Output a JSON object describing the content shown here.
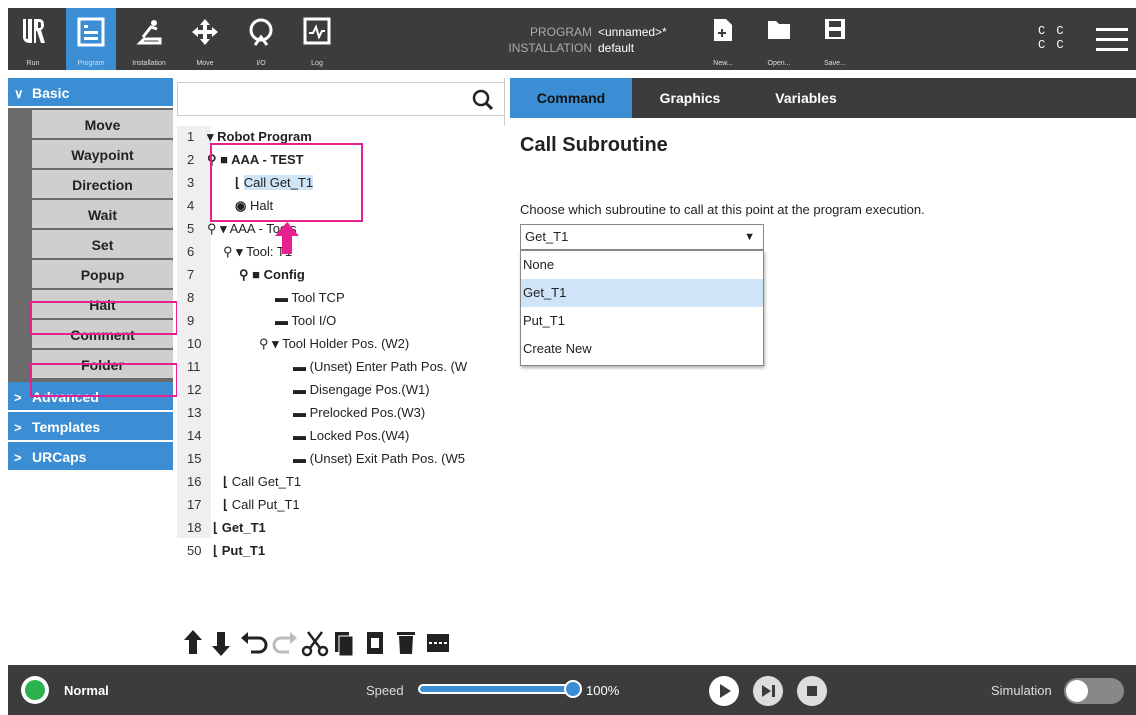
{
  "topbar": {
    "nav": [
      {
        "label": "Run",
        "icon": "ur-logo-icon"
      },
      {
        "label": "Program",
        "icon": "program-icon",
        "active": true
      },
      {
        "label": "Installation",
        "icon": "installation-icon"
      },
      {
        "label": "Move",
        "icon": "move-icon"
      },
      {
        "label": "I/O",
        "icon": "io-icon"
      },
      {
        "label": "Log",
        "icon": "log-icon"
      }
    ],
    "program_key": "PROGRAM",
    "program_value": "<unnamed>*",
    "installation_key": "INSTALLATION",
    "installation_value": "default",
    "file_buttons": [
      {
        "label": "New...",
        "icon": "new-file-icon"
      },
      {
        "label": "Open...",
        "icon": "folder-icon"
      },
      {
        "label": "Save...",
        "icon": "save-icon"
      }
    ],
    "cc_line1": "C C",
    "cc_line2": "C C"
  },
  "sidebar": {
    "basic_label": "Basic",
    "basic_items": [
      "Move",
      "Waypoint",
      "Direction",
      "Wait",
      "Set",
      "Popup",
      "Halt",
      "Comment",
      "Folder"
    ],
    "other_categories": [
      "Advanced",
      "Templates",
      "URCaps"
    ]
  },
  "tree": {
    "rows": [
      {
        "ln": "1",
        "text": "Robot Program"
      },
      {
        "ln": "2",
        "text": "AAA - TEST"
      },
      {
        "ln": "3",
        "text": "Call Get_T1"
      },
      {
        "ln": "4",
        "text": "Halt"
      },
      {
        "ln": "5",
        "text": "AAA - Tools"
      },
      {
        "ln": "6",
        "text": "Tool: T1"
      },
      {
        "ln": "7",
        "text": "Config"
      },
      {
        "ln": "8",
        "text": "Tool TCP"
      },
      {
        "ln": "9",
        "text": "Tool I/O"
      },
      {
        "ln": "10",
        "text": "Tool Holder Pos. (W2)"
      },
      {
        "ln": "11",
        "text": "(Unset) Enter Path Pos. (W"
      },
      {
        "ln": "12",
        "text": "Disengage Pos.(W1)"
      },
      {
        "ln": "13",
        "text": "Prelocked Pos.(W3)"
      },
      {
        "ln": "14",
        "text": "Locked Pos.(W4)"
      },
      {
        "ln": "15",
        "text": "(Unset) Exit Path Pos. (W5"
      },
      {
        "ln": "16",
        "text": "Call Get_T1"
      },
      {
        "ln": "17",
        "text": "Call Put_T1"
      },
      {
        "ln": "18",
        "text": "Get_T1"
      },
      {
        "ln": "50",
        "text": "Put_T1"
      }
    ]
  },
  "right": {
    "tabs": [
      "Command",
      "Graphics",
      "Variables"
    ],
    "title": "Call Subroutine",
    "description": "Choose which subroutine to call at this point at the program execution.",
    "dropdown_value": "Get_T1",
    "options": [
      "None",
      "Get_T1",
      "Put_T1",
      "Create New"
    ]
  },
  "bottombar": {
    "status": "Normal",
    "speed_label": "Speed",
    "speed_value": "100%",
    "speed_fraction": 1.0,
    "simulation_label": "Simulation"
  },
  "colors": {
    "accent": "#3b8ed3",
    "highlight": "#e7208f",
    "dark": "#3c3c3c"
  }
}
